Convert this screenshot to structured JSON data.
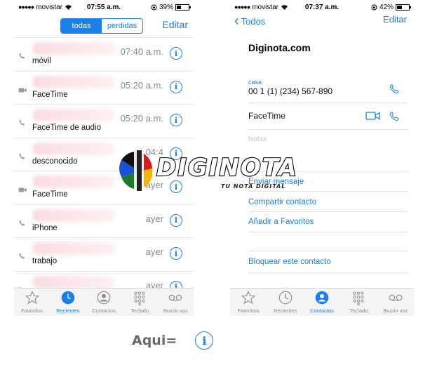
{
  "left_screen": {
    "status": {
      "carrier": "movistar",
      "time": "07:55 a.m.",
      "battery": "39%",
      "battery_level": 0.39
    },
    "nav": {
      "segments": [
        "todas",
        "perdidas"
      ],
      "active_segment": 0,
      "edit_label": "Editar"
    },
    "calls": [
      {
        "type_icon": "phone-icon",
        "label": "móvil",
        "time": "07:40 a.m."
      },
      {
        "type_icon": "video-icon",
        "label": "FaceTime",
        "time": "05:20 a.m."
      },
      {
        "type_icon": "phone-icon",
        "label": "FaceTime de audio",
        "time": "05:20 a.m."
      },
      {
        "type_icon": "phone-icon",
        "label": "desconocido",
        "time": "04:4"
      },
      {
        "type_icon": "video-icon",
        "label": "FaceTime",
        "time": "ayer"
      },
      {
        "type_icon": "phone-icon",
        "label": "iPhone",
        "time": "ayer"
      },
      {
        "type_icon": "phone-icon",
        "label": "trabajo",
        "time": "ayer"
      },
      {
        "type_icon": "phone-icon",
        "label": "",
        "time": "ayer"
      }
    ],
    "tabs": [
      {
        "label": "Favoritos",
        "icon": "star-icon"
      },
      {
        "label": "Recientes",
        "icon": "clock-icon"
      },
      {
        "label": "Contactos",
        "icon": "contacts-icon"
      },
      {
        "label": "Teclado",
        "icon": "keypad-icon"
      },
      {
        "label": "Buzón voz",
        "icon": "voicemail-icon"
      }
    ],
    "active_tab": 1
  },
  "right_screen": {
    "status": {
      "carrier": "movistar",
      "time": "07:37 a.m.",
      "battery": "42%",
      "battery_level": 0.42
    },
    "nav": {
      "back_label": "Todos",
      "edit_label": "Editar"
    },
    "contact": {
      "name": "Diginota.com",
      "phone_label": "casa",
      "phone_number": "00 1 (1) (234) 567-890",
      "facetime_label": "FaceTime",
      "notes_placeholder": "Notas"
    },
    "actions": [
      "Enviar mensaje",
      "Compartir contacto",
      "Añadir a Favoritos",
      "Bloquear este contacto"
    ],
    "tabs": [
      {
        "label": "Favoritos",
        "icon": "star-icon"
      },
      {
        "label": "Recientes",
        "icon": "clock-icon"
      },
      {
        "label": "Contactos",
        "icon": "contacts-icon"
      },
      {
        "label": "Teclado",
        "icon": "keypad-icon"
      },
      {
        "label": "Buzón voz",
        "icon": "voicemail-icon"
      }
    ],
    "active_tab": 2
  },
  "watermark": {
    "title": "DIGINOTA",
    "tagline": "TU NOTA DIGITAL"
  },
  "legend": {
    "label": "Aqui=",
    "info_glyph": "i"
  },
  "colors": {
    "accent": "#1a7fe6"
  }
}
